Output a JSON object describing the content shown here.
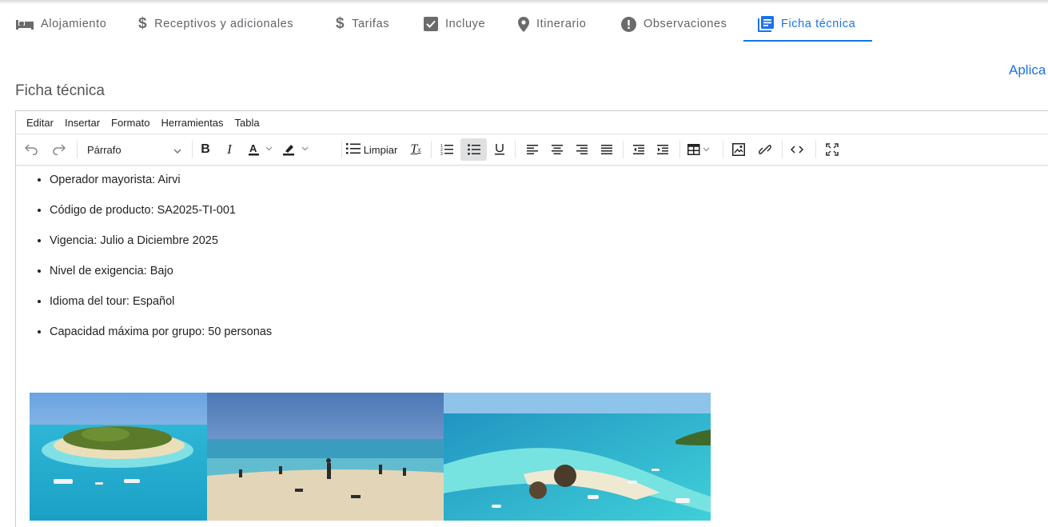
{
  "tabs": [
    {
      "label": "Alojamiento",
      "icon": "bed-icon"
    },
    {
      "label": "Receptivos y adicionales",
      "icon": "dollar-icon"
    },
    {
      "label": "Tarifas",
      "icon": "dollar-icon"
    },
    {
      "label": "Incluye",
      "icon": "checkbox-icon"
    },
    {
      "label": "Itinerario",
      "icon": "location-pin-icon"
    },
    {
      "label": "Observaciones",
      "icon": "alert-circle-icon"
    },
    {
      "label": "Ficha técnica",
      "icon": "document-icon",
      "active": true
    }
  ],
  "apply_label": "Aplica",
  "section_title": "Ficha técnica",
  "editor": {
    "menu": [
      "Editar",
      "Insertar",
      "Formato",
      "Herramientas",
      "Tabla"
    ],
    "toolbar": {
      "block_format": "Párrafo",
      "clear_label": "Limpiar"
    },
    "items": [
      "Operador mayorista: Airvi",
      "Código de producto: SA2025-TI-001",
      "Vigencia: Julio a Diciembre 2025",
      "Nivel de exigencia: Bajo",
      "Idioma del tour: Español",
      "Capacidad máxima por grupo: 50 personas"
    ]
  },
  "colors": {
    "accent": "#1a73e8",
    "text": "#222222",
    "muted": "#5f6368"
  }
}
